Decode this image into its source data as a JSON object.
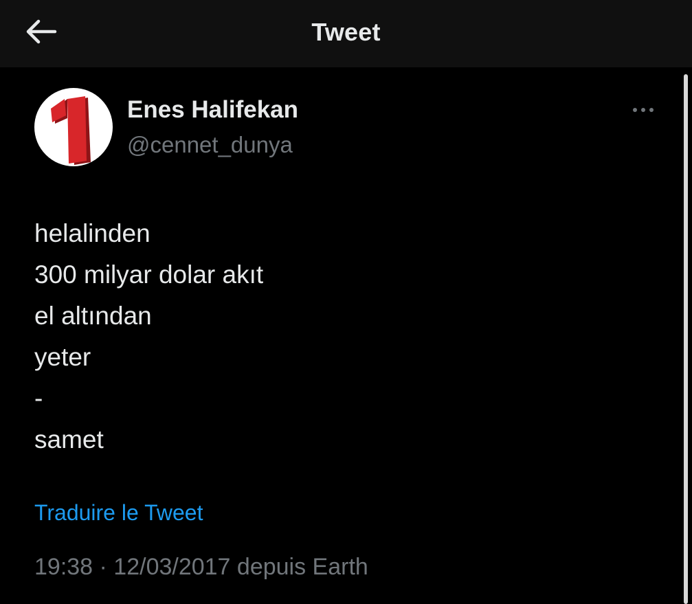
{
  "header": {
    "title": "Tweet",
    "back_icon": "arrow-left-icon"
  },
  "author": {
    "display_name": "Enes Halifekan",
    "handle": "@cennet_dunya",
    "avatar_icon": "number-one-logo-icon",
    "avatar_colors": {
      "background": "#ffffff",
      "digit": "#d8262a"
    }
  },
  "tweet": {
    "lines": [
      "helalinden",
      "300 milyar dolar akıt",
      "el altından",
      "yeter",
      "-",
      "samet"
    ],
    "translate_label": "Traduire le Tweet",
    "timestamp": "19:38 · 12/03/2017 depuis Earth"
  },
  "more_icon": "more-horizontal-icon",
  "colors": {
    "background": "#000000",
    "header_background": "#101010",
    "text_primary": "#e7e9ea",
    "text_secondary": "#71767b",
    "link": "#1d9bf0"
  }
}
